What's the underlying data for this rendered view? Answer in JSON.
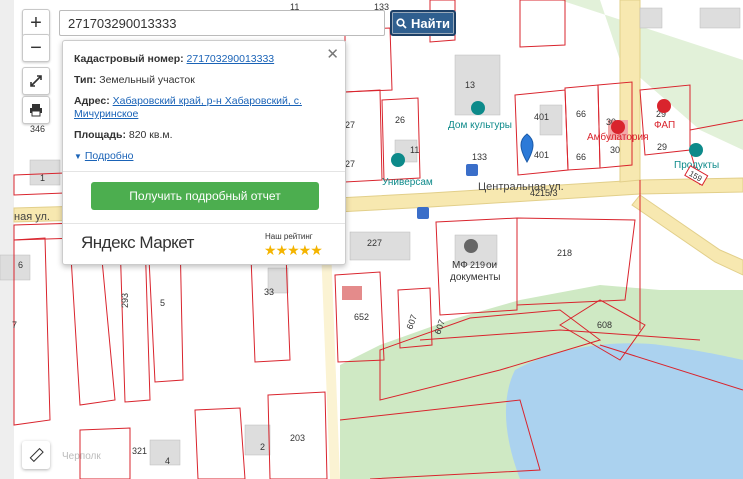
{
  "search": {
    "value": "271703290013333",
    "button_label": "Найти"
  },
  "controls": {
    "zoom_in": "+",
    "zoom_out": "−"
  },
  "popup": {
    "cadastral_label": "Кадастровый номер:",
    "cadastral_value": "271703290013333",
    "type_label": "Тип:",
    "type_value": "Земельный участок",
    "address_label": "Адрес:",
    "address_value_1": "Хабаровский край, р-н Хабаровский, с.",
    "address_value_2": "Мичуринское",
    "area_label": "Площадь:",
    "area_value": "820 кв.м.",
    "details_link": "Подробно",
    "report_button": "Получить подробный отчет",
    "brand": "Яндекс Маркет",
    "rating_label": "Наш рейтинг",
    "rating_stars": "★★★★★",
    "close": "✕"
  },
  "map_labels": {
    "street_main": "Центральная ул.",
    "street_left": "ная ул.",
    "house_of_culture": "Дом культуры",
    "universam": "Универсам",
    "produkty": "Продукты",
    "fap": "ФАП",
    "ambulatoria": "Амбулатория",
    "mfc_1": "МФ",
    "mfc_2": "ои",
    "mfc_3": "документы",
    "watermark": "Черполк",
    "badge_159": "159"
  },
  "parcel_numbers": [
    "11",
    "133",
    "13",
    "401",
    "66",
    "30",
    "29",
    "346",
    "27",
    "26",
    "11",
    "27",
    "1",
    "26",
    "133",
    "401",
    "66",
    "30",
    "29",
    "4215/3",
    "227",
    "219",
    "218",
    "6",
    "293",
    "5",
    "33",
    "652",
    "607",
    "607",
    "608",
    "7",
    "321",
    "4",
    "2",
    "203"
  ],
  "colors": {
    "accent": "#2f5f8f",
    "parcel": "#d9242d",
    "road": "#f7e8b0",
    "green": "#cfe9c4",
    "water": "#abd2ef",
    "report": "#4cae4f"
  }
}
